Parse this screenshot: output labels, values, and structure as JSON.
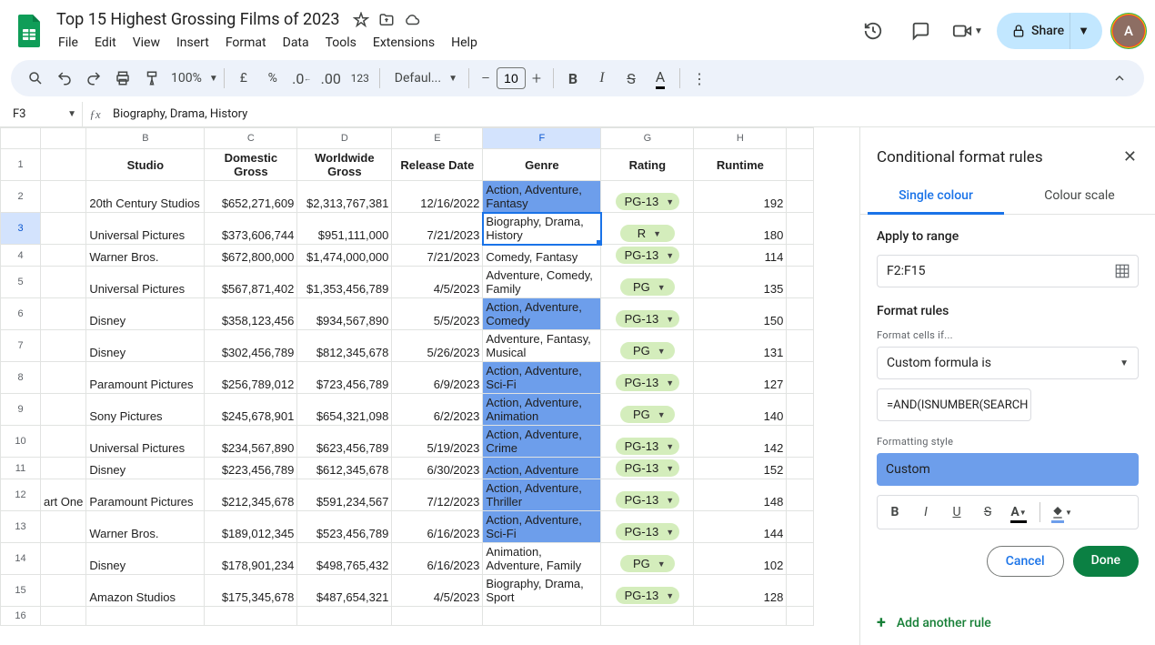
{
  "doc": {
    "title": "Top 15 Highest Grossing Films of 2023"
  },
  "menu": {
    "file": "File",
    "edit": "Edit",
    "view": "View",
    "insert": "Insert",
    "format": "Format",
    "data": "Data",
    "tools": "Tools",
    "extensions": "Extensions",
    "help": "Help"
  },
  "share": {
    "label": "Share"
  },
  "avatar": {
    "letter": "A"
  },
  "toolbar": {
    "zoom": "100%",
    "currency_unit": "£",
    "percent": "%",
    "fmt123": "123",
    "font": "Defaul...",
    "size": "10"
  },
  "formula_bar": {
    "name_box": "F3",
    "formula": "Biography, Drama, History"
  },
  "columns": [
    "",
    "B",
    "C",
    "D",
    "E",
    "F",
    "G",
    "H",
    ""
  ],
  "headers": {
    "studio": "Studio",
    "domestic": "Domestic Gross",
    "worldwide": "Worldwide Gross",
    "release": "Release Date",
    "genre": "Genre",
    "rating": "Rating",
    "runtime": "Runtime"
  },
  "rows": [
    {
      "num": "2",
      "atail": "",
      "studio": "20th Century Studios",
      "dom": "$652,271,609",
      "ww": "$2,313,767,381",
      "rel": "12/16/2022",
      "genre": "Action, Adventure, Fantasy",
      "hl": true,
      "rating": "PG-13",
      "rt": "192"
    },
    {
      "num": "3",
      "atail": "",
      "studio": "Universal Pictures",
      "dom": "$373,606,744",
      "ww": "$951,111,000",
      "rel": "7/21/2023",
      "genre": "Biography, Drama, History",
      "hl": false,
      "rating": "R",
      "rt": "180",
      "selected": true
    },
    {
      "num": "4",
      "atail": "",
      "studio": "Warner Bros.",
      "dom": "$672,800,000",
      "ww": "$1,474,000,000",
      "rel": "7/21/2023",
      "genre": "Comedy, Fantasy",
      "hl": false,
      "rating": "PG-13",
      "rt": "114"
    },
    {
      "num": "5",
      "atail": "",
      "studio": "Universal Pictures",
      "dom": "$567,871,402",
      "ww": "$1,353,456,789",
      "rel": "4/5/2023",
      "genre": "Adventure, Comedy, Family",
      "hl": false,
      "rating": "PG",
      "rt": "135"
    },
    {
      "num": "6",
      "atail": "",
      "studio": "Disney",
      "dom": "$358,123,456",
      "ww": "$934,567,890",
      "rel": "5/5/2023",
      "genre": "Action, Adventure, Comedy",
      "hl": true,
      "rating": "PG-13",
      "rt": "150"
    },
    {
      "num": "7",
      "atail": "",
      "studio": "Disney",
      "dom": "$302,456,789",
      "ww": "$812,345,678",
      "rel": "5/26/2023",
      "genre": "Adventure, Fantasy, Musical",
      "hl": false,
      "rating": "PG",
      "rt": "131"
    },
    {
      "num": "8",
      "atail": "",
      "studio": "Paramount Pictures",
      "dom": "$256,789,012",
      "ww": "$723,456,789",
      "rel": "6/9/2023",
      "genre": "Action, Adventure, Sci-Fi",
      "hl": true,
      "rating": "PG-13",
      "rt": "127"
    },
    {
      "num": "9",
      "atail": "",
      "studio": "Sony Pictures",
      "dom": "$245,678,901",
      "ww": "$654,321,098",
      "rel": "6/2/2023",
      "genre": "Action, Adventure, Animation",
      "hl": true,
      "rating": "PG",
      "rt": "140"
    },
    {
      "num": "10",
      "atail": "",
      "studio": "Universal Pictures",
      "dom": "$234,567,890",
      "ww": "$623,456,789",
      "rel": "5/19/2023",
      "genre": "Action, Adventure, Crime",
      "hl": true,
      "rating": "PG-13",
      "rt": "142"
    },
    {
      "num": "11",
      "atail": "",
      "studio": "Disney",
      "dom": "$223,456,789",
      "ww": "$612,345,678",
      "rel": "6/30/2023",
      "genre": "Action, Adventure",
      "hl": true,
      "rating": "PG-13",
      "rt": "152"
    },
    {
      "num": "12",
      "atail": "art One",
      "studio": "Paramount Pictures",
      "dom": "$212,345,678",
      "ww": "$591,234,567",
      "rel": "7/12/2023",
      "genre": "Action, Adventure, Thriller",
      "hl": true,
      "rating": "PG-13",
      "rt": "148"
    },
    {
      "num": "13",
      "atail": "",
      "studio": "Warner Bros.",
      "dom": "$189,012,345",
      "ww": "$523,456,789",
      "rel": "6/16/2023",
      "genre": "Action, Adventure, Sci-Fi",
      "hl": true,
      "rating": "PG-13",
      "rt": "144"
    },
    {
      "num": "14",
      "atail": "",
      "studio": "Disney",
      "dom": "$178,901,234",
      "ww": "$498,765,432",
      "rel": "6/16/2023",
      "genre": "Animation, Adventure, Family",
      "hl": false,
      "rating": "PG",
      "rt": "102"
    },
    {
      "num": "15",
      "atail": "",
      "studio": "Amazon Studios",
      "dom": "$175,345,678",
      "ww": "$487,654,321",
      "rel": "4/5/2023",
      "genre": "Biography, Drama, Sport",
      "hl": false,
      "rating": "PG-13",
      "rt": "128"
    }
  ],
  "extra_rows": [
    "16"
  ],
  "sidebar": {
    "title": "Conditional format rules",
    "tabs": {
      "single": "Single colour",
      "scale": "Colour scale"
    },
    "apply_label": "Apply to range",
    "range": "F2:F15",
    "rules_label": "Format rules",
    "cells_if": "Format cells if...",
    "condition": "Custom formula is",
    "formula": "=AND(ISNUMBER(SEARCH",
    "style_label": "Formatting style",
    "style_name": "Custom",
    "cancel": "Cancel",
    "done": "Done",
    "add_rule": "Add another rule"
  }
}
